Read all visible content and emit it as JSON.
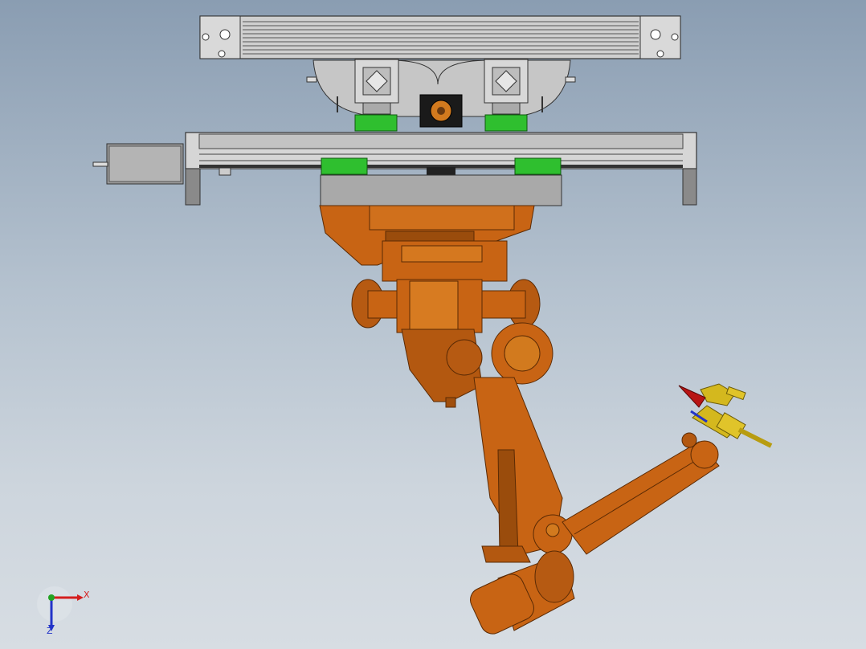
{
  "viewport": {
    "background_top": "#8a9db2",
    "background_bottom": "#d7dde3"
  },
  "model": {
    "colors": {
      "frame": "#c9c9c9",
      "frame_dark": "#8d8d8d",
      "rail_green": "#2fbf2f",
      "robot_orange": "#c86414",
      "robot_orange_dark": "#8a3f08",
      "tool_yellow": "#d4b81e",
      "cone_red": "#b81414"
    }
  },
  "triad": {
    "x_label": "X",
    "z_label": "Z",
    "x_color": "#d41e1e",
    "y_color": "#22a322",
    "z_color": "#2233c8"
  }
}
